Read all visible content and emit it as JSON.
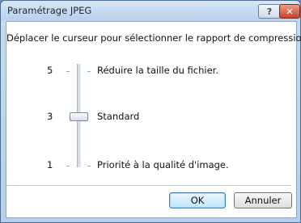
{
  "window": {
    "title": "Paramétrage JPEG",
    "help_icon": "?",
    "close_icon": "✕"
  },
  "instruction": "Déplacer le curseur pour sélectionner le rapport de compression.",
  "slider": {
    "min": 1,
    "max": 5,
    "value": 3,
    "ticks": [
      {
        "number": "5",
        "label": "Réduire la taille du fichier."
      },
      {
        "number": "3",
        "label": "Standard"
      },
      {
        "number": "1",
        "label": "Priorité à la qualité d'image."
      }
    ]
  },
  "buttons": {
    "ok": "OK",
    "cancel": "Annuler"
  }
}
